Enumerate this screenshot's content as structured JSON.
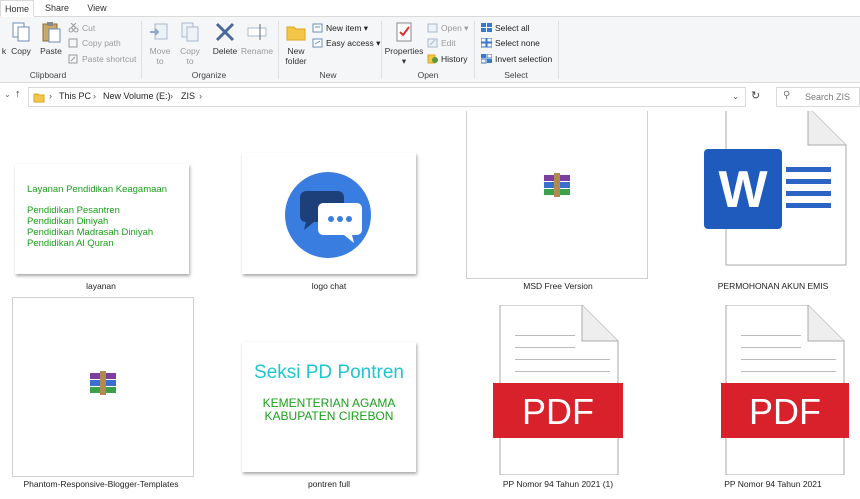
{
  "tabs": [
    "Home",
    "Share",
    "View"
  ],
  "ribbon": {
    "clipboard": {
      "cut_partial": "k",
      "copy": "Copy",
      "paste": "Paste",
      "cut": "Cut",
      "copy_path": "Copy path",
      "paste_shortcut": "Paste shortcut",
      "label": "Clipboard"
    },
    "organize": {
      "move_to": "Move",
      "move_to2": "to",
      "copy_to": "Copy",
      "copy_to2": "to",
      "delete": "Delete",
      "rename": "Rename",
      "label": "Organize"
    },
    "new": {
      "new_folder": "New",
      "new_folder2": "folder",
      "new_item": "New item",
      "easy_access": "Easy access",
      "label": "New"
    },
    "open": {
      "properties": "Properties",
      "open": "Open",
      "edit": "Edit",
      "history": "History",
      "label": "Open"
    },
    "select": {
      "select_all": "Select all",
      "select_none": "Select none",
      "invert": "Invert selection",
      "label": "Select"
    }
  },
  "address": {
    "segments": [
      "This PC",
      "New Volume (E:)",
      "ZIS"
    ],
    "search_placeholder": "Search ZIS"
  },
  "files": [
    {
      "name": "layanan",
      "lines": [
        "Layanan Pendidikan Keagamaan",
        "Pendidikan Pesantren",
        "Pendidikan Diniyah",
        "Pendidikan Madrasah Diniyah",
        "Pendidikan Al Quran"
      ]
    },
    {
      "name": "logo chat"
    },
    {
      "name": "MSD Free Version"
    },
    {
      "name": "PERMOHONAN AKUN EMIS",
      "icon_letter": "W"
    },
    {
      "name": "Phantom-Responsive-Blogger-Templates"
    },
    {
      "name": "pontren full",
      "lines": [
        "Seksi PD Pontren",
        "KEMENTERIAN AGAMA",
        "KABUPATEN CIREBON"
      ]
    },
    {
      "name": "PP Nomor 94 Tahun 2021 (1)",
      "icon_text": "PDF"
    },
    {
      "name": "PP Nomor 94 Tahun 2021",
      "icon_text": "PDF"
    }
  ]
}
